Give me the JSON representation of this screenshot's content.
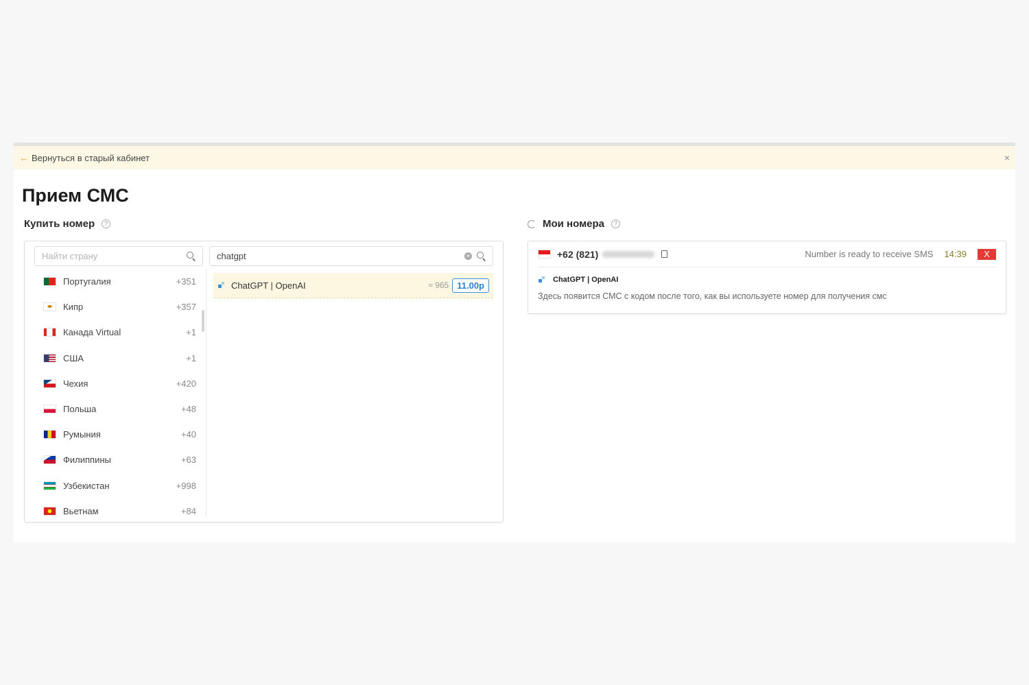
{
  "banner": {
    "back_label": "Вернуться в старый кабинет",
    "close": "×"
  },
  "page_title": "Прием СМС",
  "buy": {
    "label": "Купить номер",
    "country_search_placeholder": "Найти страну",
    "service_search_value": "chatgpt",
    "countries": [
      {
        "name": "Португалия",
        "code": "+351",
        "flag": "portugal-flag-icon"
      },
      {
        "name": "Кипр",
        "code": "+357",
        "flag": "cyprus-flag-icon"
      },
      {
        "name": "Канада Virtual",
        "code": "+1",
        "flag": "canada-flag-icon"
      },
      {
        "name": "США",
        "code": "+1",
        "flag": "usa-flag-icon"
      },
      {
        "name": "Чехия",
        "code": "+420",
        "flag": "czech-flag-icon"
      },
      {
        "name": "Польша",
        "code": "+48",
        "flag": "poland-flag-icon"
      },
      {
        "name": "Румыния",
        "code": "+40",
        "flag": "romania-flag-icon"
      },
      {
        "name": "Филиппины",
        "code": "+63",
        "flag": "philippines-flag-icon"
      },
      {
        "name": "Узбекистан",
        "code": "+998",
        "flag": "uzbekistan-flag-icon"
      },
      {
        "name": "Вьетнам",
        "code": "+84",
        "flag": "vietnam-flag-icon"
      }
    ],
    "service": {
      "name": "ChatGPT | OpenAI",
      "count": "≈ 965",
      "price": "11.00р"
    }
  },
  "my_numbers": {
    "label": "Мои номера",
    "number": {
      "prefix": "+62 (821)",
      "status": "Number is ready to receive SMS",
      "timer": "14:39",
      "cancel": "X",
      "service": "ChatGPT | OpenAI",
      "hint": "Здесь появится СМС с кодом после того, как вы используете номер для получения смс"
    }
  },
  "colors": {
    "accent_blue": "#3b8fd9",
    "banner_bg": "#fdf8e5",
    "cancel_red": "#e53935",
    "arrow_orange": "#e9a93a"
  }
}
